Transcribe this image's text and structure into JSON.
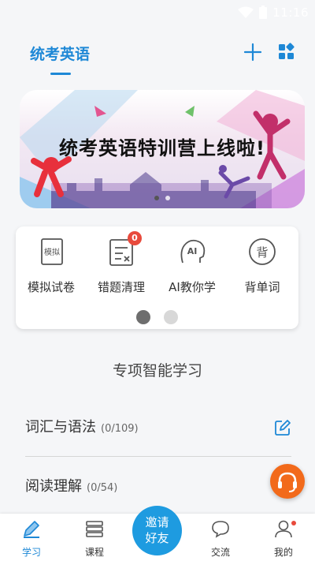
{
  "status_bar": {
    "time": "11:16"
  },
  "header": {
    "title": "统考英语"
  },
  "banner": {
    "text": "统考英语特训营上线啦!"
  },
  "tools": [
    {
      "label": "模拟试卷",
      "icon": "mock-exam-icon",
      "icon_text": "模拟"
    },
    {
      "label": "错题清理",
      "icon": "wrong-questions-icon",
      "badge": "0"
    },
    {
      "label": "AI教你学",
      "icon": "ai-tutor-icon",
      "icon_text": "AI"
    },
    {
      "label": "背单词",
      "icon": "vocabulary-icon",
      "icon_text": "背"
    }
  ],
  "section": {
    "title": "专项智能学习"
  },
  "topics": [
    {
      "name": "词汇与语法",
      "count": "(0/109)"
    },
    {
      "name": "阅读理解",
      "count": "(0/54)"
    }
  ],
  "bottom_nav": {
    "study": "学习",
    "courses": "课程",
    "invite": [
      "邀请",
      "好友"
    ],
    "community": "交流",
    "mine": "我的"
  },
  "colors": {
    "accent": "#1e88d6",
    "badge": "#e84a3c",
    "support": "#f26a1b"
  }
}
